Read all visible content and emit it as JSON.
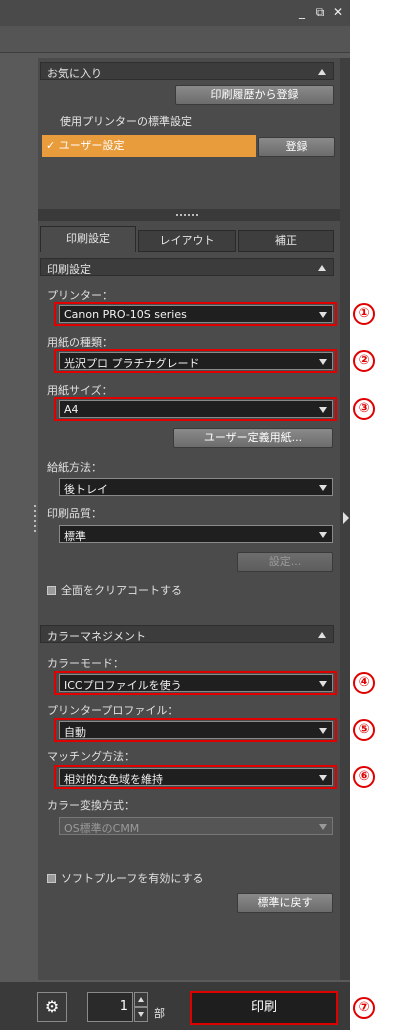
{
  "window": {
    "controls": {
      "minimize": "_",
      "restore": "⧉",
      "close": "✕"
    }
  },
  "favorites": {
    "header": "お気に入り",
    "register_history_button": "印刷履歴から登録",
    "items": [
      {
        "label": "使用プリンターの標準設定",
        "selected": false
      },
      {
        "label": "ユーザー設定",
        "selected": true,
        "check": "✓"
      }
    ],
    "register_button": "登録"
  },
  "tabs": [
    {
      "label": "印刷設定",
      "active": true
    },
    {
      "label": "レイアウト",
      "active": false
    },
    {
      "label": "補正",
      "active": false
    }
  ],
  "print_settings": {
    "header": "印刷設定",
    "printer": {
      "label": "プリンター：",
      "value": "Canon PRO-10S series",
      "marker": "①"
    },
    "media_type": {
      "label": "用紙の種類：",
      "value": "光沢プロ プラチナグレード",
      "marker": "②"
    },
    "paper_size": {
      "label": "用紙サイズ：",
      "value": "A4",
      "marker": "③"
    },
    "custom_size_button": "ユーザー定義用紙...",
    "paper_source": {
      "label": "給紙方法：",
      "value": "後トレイ"
    },
    "print_quality": {
      "label": "印刷品質：",
      "value": "標準"
    },
    "quality_settings_button": "設定...",
    "clear_coat_all": {
      "label": "全面をクリアコートする",
      "checked": false
    }
  },
  "color_management": {
    "header": "カラーマネジメント",
    "color_mode": {
      "label": "カラーモード：",
      "value": "ICCプロファイルを使う",
      "marker": "④"
    },
    "printer_profile": {
      "label": "プリンタープロファイル：",
      "value": "自動",
      "marker": "⑤"
    },
    "rendering_intent": {
      "label": "マッチング方法：",
      "value": "相対的な色域を維持",
      "marker": "⑥"
    },
    "conversion_method": {
      "label": "カラー変換方式：",
      "value": "OS標準のCMM"
    },
    "soft_proof": {
      "label": "ソフトプルーフを有効にする",
      "checked": false
    },
    "defaults_button": "標準に戻す"
  },
  "footer": {
    "gear_icon": "⚙",
    "copies_value": "1",
    "copies_unit": "部",
    "print_button": "印刷",
    "marker": "⑦"
  },
  "colors": {
    "selection": "#e89c3c",
    "highlight_red": "#e00000"
  }
}
